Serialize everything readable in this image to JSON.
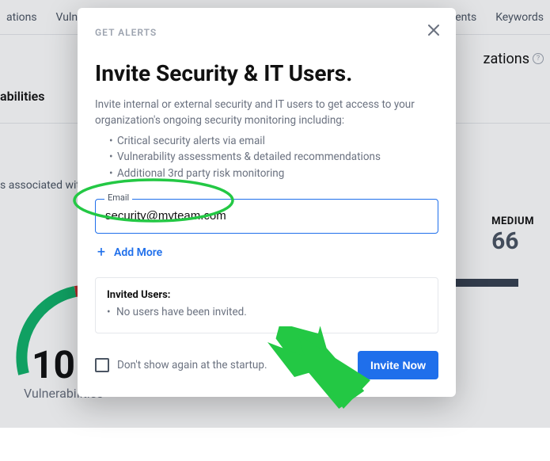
{
  "nav": {
    "left": [
      "ations",
      "Vulnera"
    ],
    "right": [
      "rrents",
      "Keywords"
    ]
  },
  "header": {
    "orgs_label": "zations"
  },
  "page": {
    "section_title": "abilities",
    "assoc_text": "s associated with t",
    "big_number": "10",
    "big_label": "Vulnerabilities",
    "medium_label": "MEDIUM",
    "medium_value": "66"
  },
  "modal": {
    "kicker": "GET ALERTS",
    "title": "Invite Security & IT Users.",
    "desc": "Invite internal or external security and IT users to get access to your organization's ongoing security monitoring including:",
    "bullets": [
      "Critical security alerts via email",
      "Vulnerability assessments & detailed recommendations",
      "Additional 3rd party risk monitoring"
    ],
    "email_label": "Email",
    "email_value": "security@myteam.com",
    "add_more": "Add More",
    "invited_label": "Invited Users:",
    "invited_empty": "No users have been invited.",
    "dont_show": "Don't show again at the startup.",
    "invite_btn": "Invite Now"
  },
  "colors": {
    "accent": "#1f6feb",
    "annotation": "#23c844"
  }
}
